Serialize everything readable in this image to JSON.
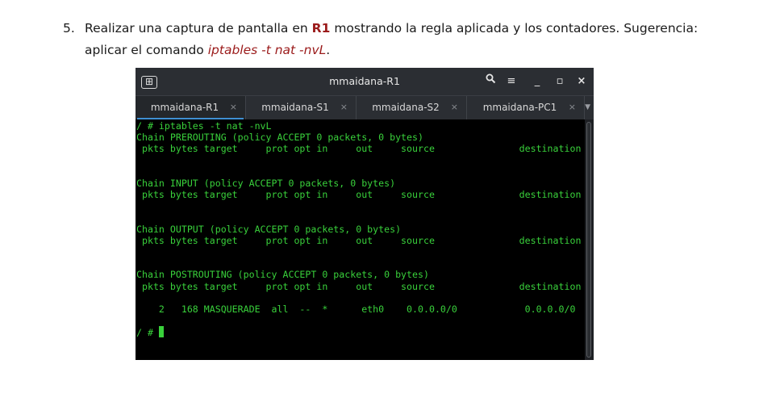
{
  "document": {
    "step_number": "5.",
    "line1_pre": "Realizar una captura de pantalla en ",
    "line1_bold": "R1",
    "line1_post": " mostrando la regla aplicada y los contadores. Sugerencia:",
    "line2_pre": "aplicar el comando ",
    "line2_cmd": "iptables -t nat -nvL",
    "line2_post": "."
  },
  "window": {
    "title": "mmaidana-R1",
    "newtab_icon": "⊞",
    "search_icon": "🔍",
    "menu_icon": "≡",
    "minimize_icon": "_",
    "maximize_icon": "▫",
    "close_icon": "×"
  },
  "tabs": [
    {
      "label": "mmaidana-R1",
      "close": "×",
      "active": true
    },
    {
      "label": "mmaidana-S1",
      "close": "×",
      "active": false
    },
    {
      "label": "mmaidana-S2",
      "close": "×",
      "active": false
    },
    {
      "label": "mmaidana-PC1",
      "close": "×",
      "active": false
    }
  ],
  "tab_scroll_icon": "▼",
  "colors": {
    "terminal_text": "#39d13b",
    "terminal_bg": "#000000",
    "accent": "#3f8fd2",
    "highlight_red": "#9b1b1b"
  },
  "terminal": {
    "lines": [
      "/ # iptables -t nat -nvL",
      "Chain PREROUTING (policy ACCEPT 0 packets, 0 bytes)",
      " pkts bytes target     prot opt in     out     source               destination",
      "",
      "",
      "Chain INPUT (policy ACCEPT 0 packets, 0 bytes)",
      " pkts bytes target     prot opt in     out     source               destination",
      "",
      "",
      "Chain OUTPUT (policy ACCEPT 0 packets, 0 bytes)",
      " pkts bytes target     prot opt in     out     source               destination",
      "",
      "",
      "Chain POSTROUTING (policy ACCEPT 0 packets, 0 bytes)",
      " pkts bytes target     prot opt in     out     source               destination",
      "",
      "    2   168 MASQUERADE  all  --  *      eth0    0.0.0.0/0            0.0.0.0/0",
      "",
      "/ # "
    ]
  }
}
